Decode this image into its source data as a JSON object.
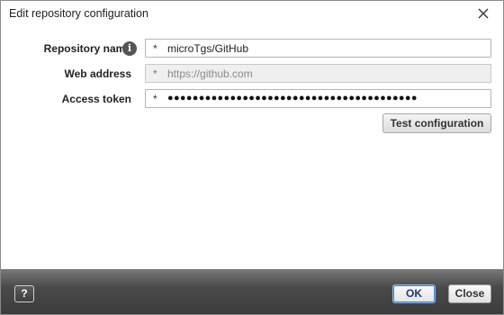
{
  "dialog": {
    "title": "Edit repository configuration"
  },
  "form": {
    "repository_name": {
      "label": "Repository name",
      "required_mark": "*",
      "value": "microTgs/GitHub"
    },
    "web_address": {
      "label": "Web address",
      "required_mark": "*",
      "value": "https://github.com"
    },
    "access_token": {
      "label": "Access token",
      "required_mark": "*",
      "value": "●●●●●●●●●●●●●●●●●●●●●●●●●●●●●●●●●●●●●●●●"
    }
  },
  "buttons": {
    "test": "Test configuration",
    "help": "?",
    "ok": "OK",
    "close": "Close"
  },
  "icons": {
    "info": "i",
    "close": "close-icon"
  }
}
